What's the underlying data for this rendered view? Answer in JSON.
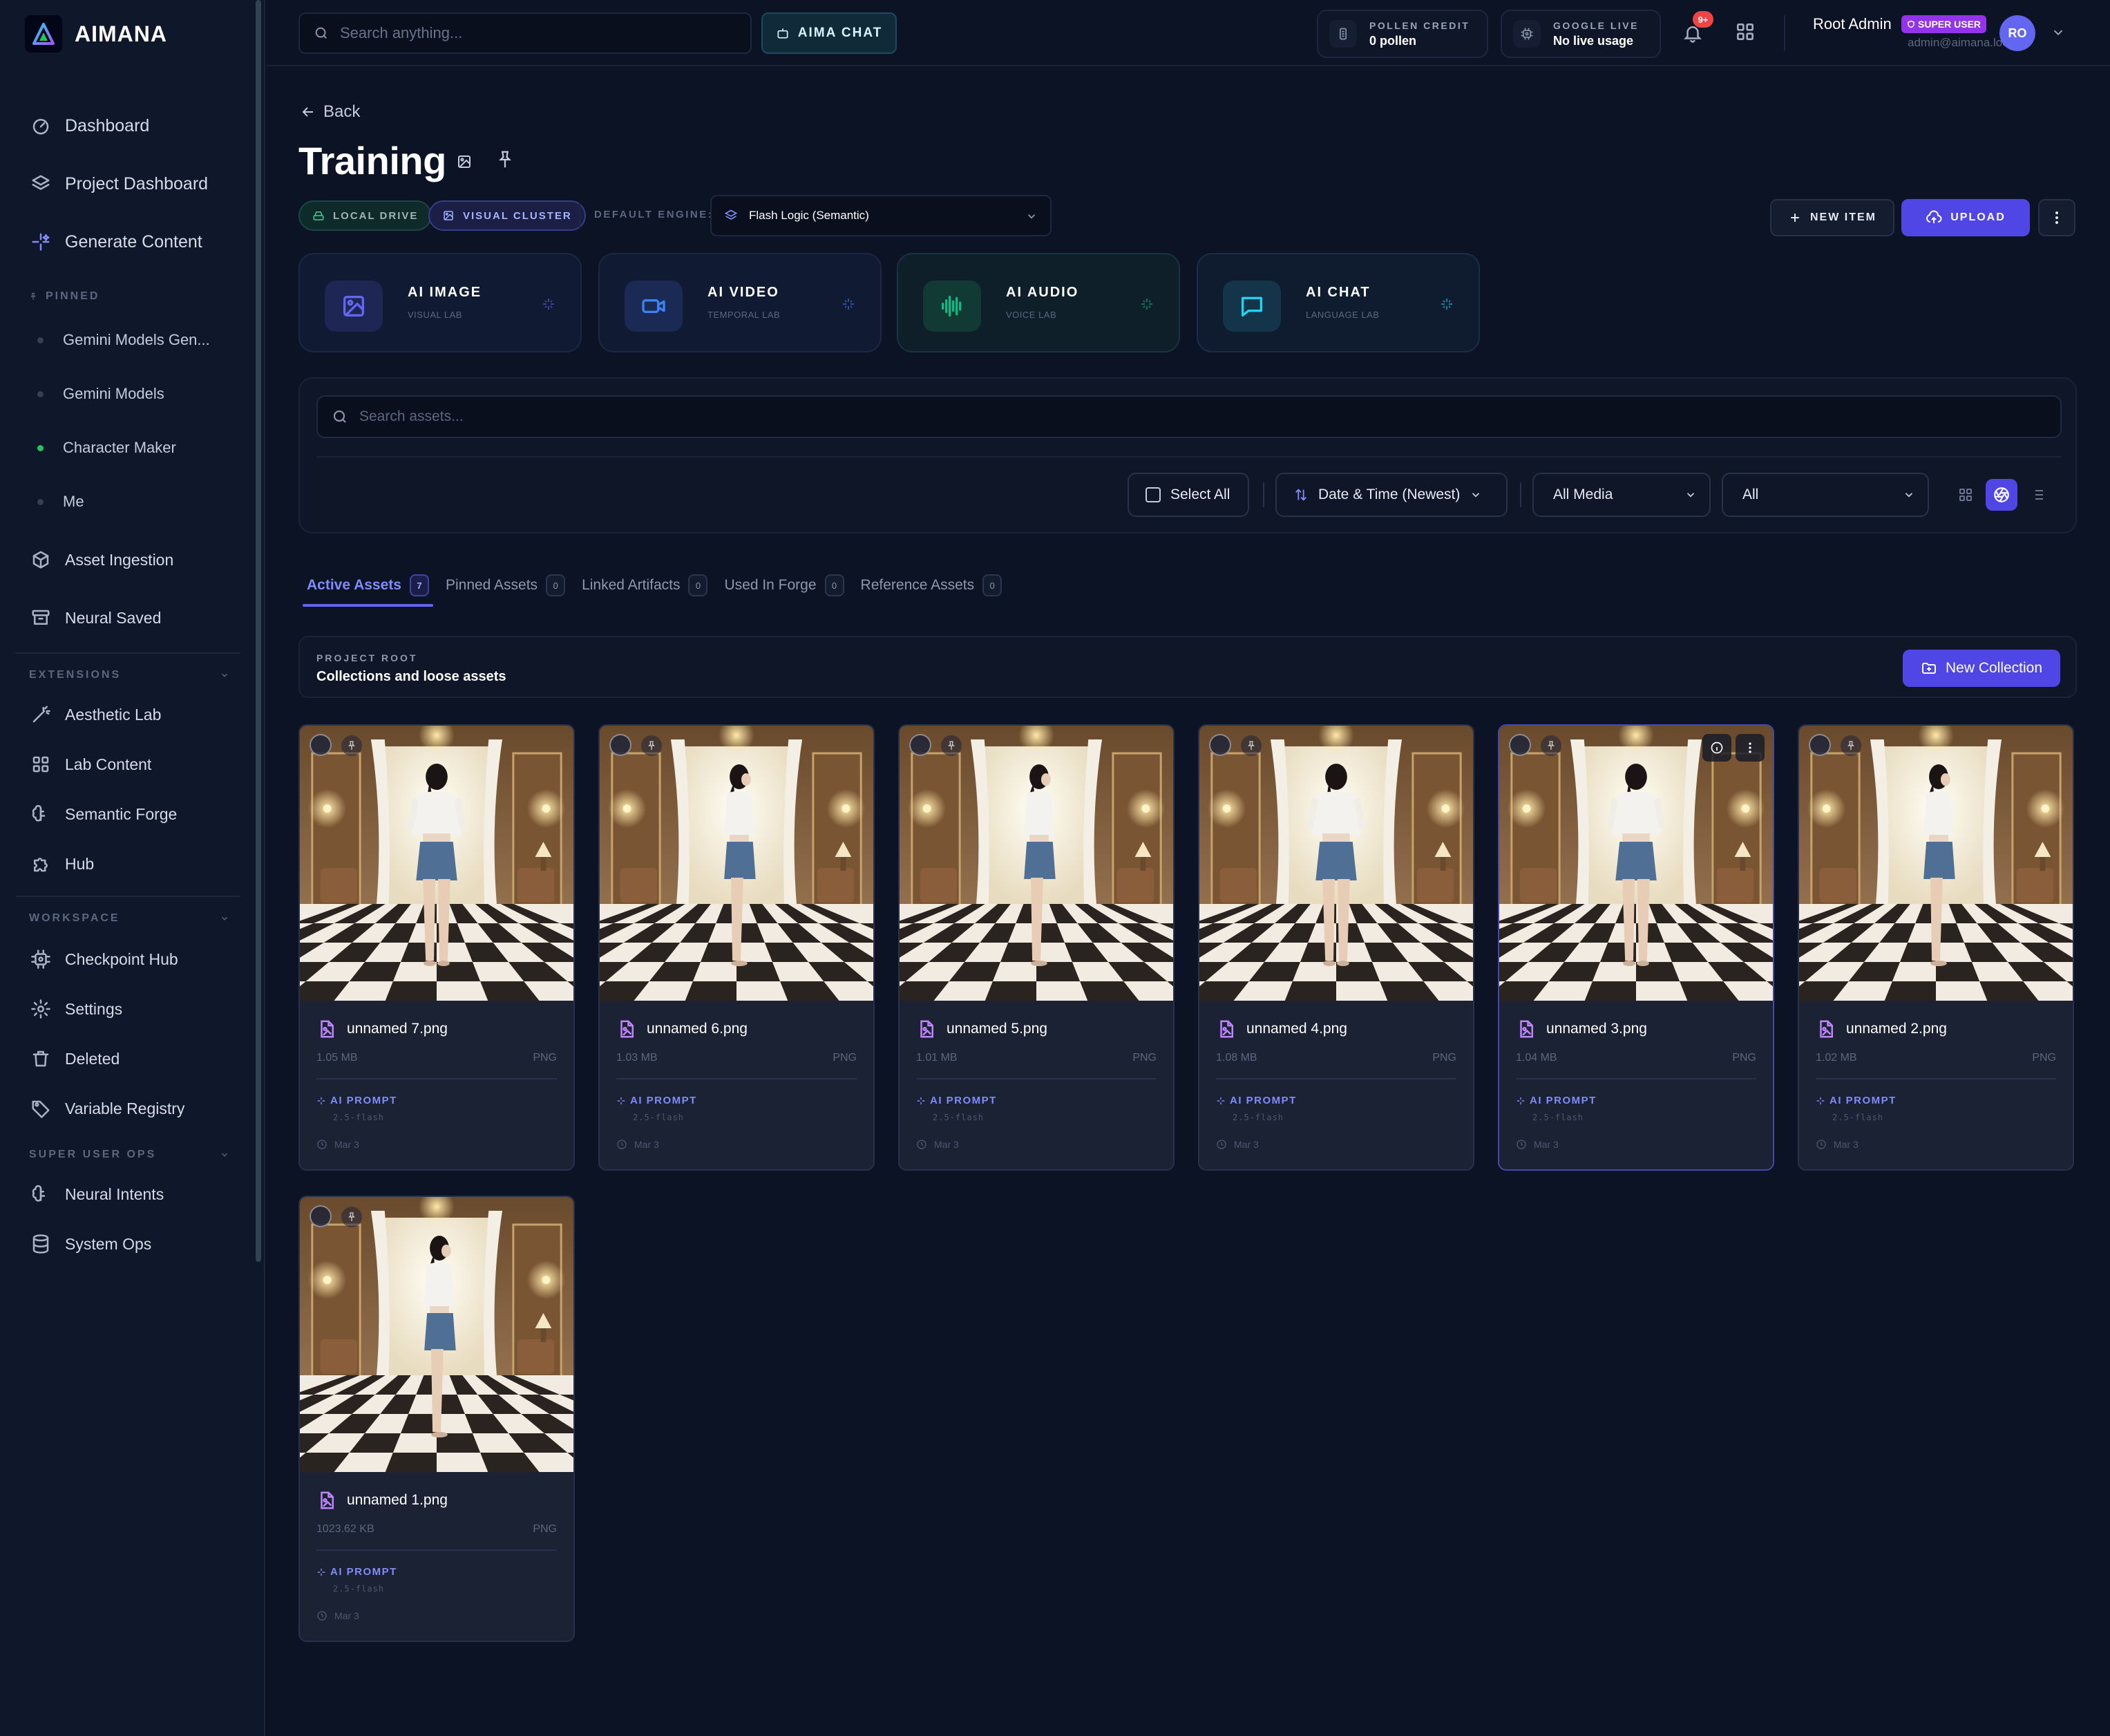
{
  "app": {
    "name": "AIMANA"
  },
  "sidebar": {
    "main": [
      {
        "label": "Dashboard",
        "icon": "gauge-icon"
      },
      {
        "label": "Project Dashboard",
        "icon": "layers-icon"
      },
      {
        "label": "Generate Content",
        "icon": "sparkles-icon"
      }
    ],
    "pinned_label": "PINNED",
    "pinned": [
      {
        "label": "Gemini Models Gen...",
        "active": false
      },
      {
        "label": "Gemini Models",
        "active": false
      },
      {
        "label": "Character Maker",
        "active": true
      },
      {
        "label": "Me",
        "active": false
      }
    ],
    "tools": [
      {
        "label": "Asset Ingestion",
        "icon": "cube-icon"
      },
      {
        "label": "Neural Saved",
        "icon": "archive-icon"
      }
    ],
    "extensions_label": "EXTENSIONS",
    "extensions": [
      {
        "label": "Aesthetic Lab",
        "icon": "wand-icon"
      },
      {
        "label": "Lab Content",
        "icon": "grid-icon"
      },
      {
        "label": "Semantic Forge",
        "icon": "brain-icon"
      },
      {
        "label": "Hub",
        "icon": "puzzle-icon"
      }
    ],
    "workspace_label": "WORKSPACE",
    "workspace": [
      {
        "label": "Checkpoint Hub",
        "icon": "cpu-icon"
      },
      {
        "label": "Settings",
        "icon": "gear-icon"
      },
      {
        "label": "Deleted",
        "icon": "trash-icon"
      },
      {
        "label": "Variable Registry",
        "icon": "tag-icon"
      }
    ],
    "superops_label": "SUPER USER OPS",
    "superops": [
      {
        "label": "Neural Intents",
        "icon": "brain-icon"
      },
      {
        "label": "System Ops",
        "icon": "database-icon"
      }
    ]
  },
  "topbar": {
    "search_placeholder": "Search anything...",
    "chat_label": "AIMA CHAT",
    "pollen_label": "POLLEN CREDIT",
    "pollen_value": "0 pollen",
    "google_label": "GOOGLE LIVE",
    "google_value": "No live usage",
    "notif_badge": "9+",
    "user_name": "Root Admin",
    "user_badge": "SUPER USER",
    "user_email": "admin@aimana.local",
    "user_initials": "RO"
  },
  "page": {
    "back_label": "Back",
    "title": "Training",
    "chip_drive": "LOCAL DRIVE",
    "chip_cluster": "VISUAL CLUSTER",
    "engine_label": "DEFAULT ENGINE:",
    "engine_value": "Flash Logic (Semantic)",
    "new_item_label": "NEW ITEM",
    "upload_label": "UPLOAD"
  },
  "labs": [
    {
      "title": "AI IMAGE",
      "sub": "VISUAL LAB",
      "accent": "#6366f1"
    },
    {
      "title": "AI VIDEO",
      "sub": "TEMPORAL LAB",
      "accent": "#3b82f6"
    },
    {
      "title": "AI AUDIO",
      "sub": "VOICE LAB",
      "accent": "#10b981"
    },
    {
      "title": "AI CHAT",
      "sub": "LANGUAGE LAB",
      "accent": "#22d3ee"
    }
  ],
  "filters": {
    "search_placeholder": "Search assets...",
    "select_all": "Select All",
    "sort": "Date & Time (Newest)",
    "media": "All Media",
    "scope": "All"
  },
  "tabs": [
    {
      "label": "Active Assets",
      "count": "7"
    },
    {
      "label": "Pinned Assets",
      "count": "0"
    },
    {
      "label": "Linked Artifacts",
      "count": "0"
    },
    {
      "label": "Used In Forge",
      "count": "0"
    },
    {
      "label": "Reference Assets",
      "count": "0"
    }
  ],
  "root": {
    "label": "PROJECT ROOT",
    "subtitle": "Collections and loose assets",
    "new_collection": "New Collection"
  },
  "assets": [
    {
      "name": "unnamed 7.png",
      "size": "1.05 MB",
      "type": "PNG",
      "prompt": "AI PROMPT",
      "model": "2.5-flash",
      "date": "Mar 3",
      "pose": "back"
    },
    {
      "name": "unnamed 6.png",
      "size": "1.03 MB",
      "type": "PNG",
      "prompt": "AI PROMPT",
      "model": "2.5-flash",
      "date": "Mar 3",
      "pose": "side"
    },
    {
      "name": "unnamed 5.png",
      "size": "1.01 MB",
      "type": "PNG",
      "prompt": "AI PROMPT",
      "model": "2.5-flash",
      "date": "Mar 3",
      "pose": "side"
    },
    {
      "name": "unnamed 4.png",
      "size": "1.08 MB",
      "type": "PNG",
      "prompt": "AI PROMPT",
      "model": "2.5-flash",
      "date": "Mar 3",
      "pose": "back"
    },
    {
      "name": "unnamed 3.png",
      "size": "1.04 MB",
      "type": "PNG",
      "prompt": "AI PROMPT",
      "model": "2.5-flash",
      "date": "Mar 3",
      "pose": "back",
      "hover": true
    },
    {
      "name": "unnamed 2.png",
      "size": "1.02 MB",
      "type": "PNG",
      "prompt": "AI PROMPT",
      "model": "2.5-flash",
      "date": "Mar 3",
      "pose": "side"
    },
    {
      "name": "unnamed 1.png",
      "size": "1023.62 KB",
      "type": "PNG",
      "prompt": "AI PROMPT",
      "model": "2.5-flash",
      "date": "Mar 3",
      "pose": "side"
    }
  ]
}
